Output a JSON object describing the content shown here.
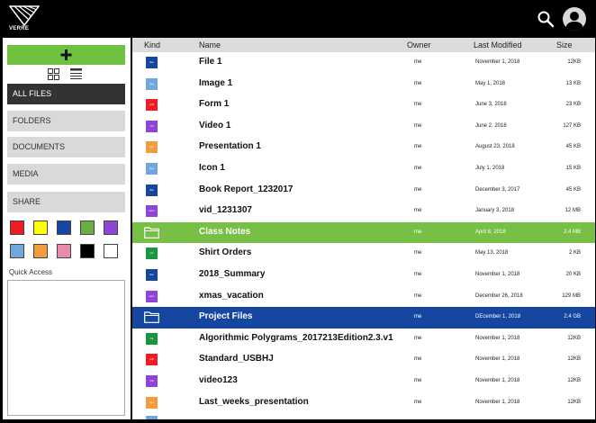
{
  "header": {
    "logo_text": "VERRE",
    "icons": {
      "search": "search-icon",
      "user": "user-icon"
    }
  },
  "sidebar": {
    "new_label": "+",
    "nav": [
      {
        "label": "ALL FILES",
        "active": true
      },
      {
        "label": "FOLDERS",
        "active": false
      },
      {
        "label": "DOCUMENTS",
        "active": false
      },
      {
        "label": "MEDIA",
        "active": false
      },
      {
        "label": "SHARE",
        "active": false
      }
    ],
    "swatches": [
      "#ee1c24",
      "#ffff00",
      "#1547a1",
      "#6cae45",
      "#8e44d6",
      "#6fa8dc",
      "#f39c3d",
      "#e98bab",
      "#000000",
      "#ffffff"
    ],
    "quick_access_label": "Quick Access"
  },
  "table": {
    "columns": {
      "kind": "Kind",
      "name": "Name",
      "owner": "Owner",
      "modified": "Last Modified",
      "size": "Size"
    },
    "rows": [
      {
        "kind": "doc",
        "kind_color": "#1547a1",
        "name": "File 1",
        "owner": "me",
        "modified": "November 1, 2018",
        "size": "12KB",
        "highlight": ""
      },
      {
        "kind": "img",
        "kind_color": "#6fa8dc",
        "name": "Image 1",
        "owner": "me",
        "modified": "May 1, 2018",
        "size": "13 KB",
        "highlight": ""
      },
      {
        "kind": "pdf",
        "kind_color": "#ee1c24",
        "name": "Form 1",
        "owner": "me",
        "modified": "June 3, 2018",
        "size": "23 KB",
        "highlight": ""
      },
      {
        "kind": "vid",
        "kind_color": "#8e44d6",
        "name": "Video 1",
        "owner": "me",
        "modified": "June 2, 2018",
        "size": "127 KB",
        "highlight": ""
      },
      {
        "kind": "ppt",
        "kind_color": "#f39c3d",
        "name": "Presentation 1",
        "owner": "me",
        "modified": "August 23, 2018",
        "size": "45 KB",
        "highlight": ""
      },
      {
        "kind": "img",
        "kind_color": "#6fa8dc",
        "name": "Icon 1",
        "owner": "me",
        "modified": "July 1, 2018",
        "size": "15 KB",
        "highlight": ""
      },
      {
        "kind": "doc",
        "kind_color": "#1547a1",
        "name": "Book Report_1232017",
        "owner": "me",
        "modified": "December 3, 2017",
        "size": "45 KB",
        "highlight": ""
      },
      {
        "kind": "wmv",
        "kind_color": "#8e44d6",
        "name": "vid_1231307",
        "owner": "me",
        "modified": "January 3, 2018",
        "size": "12 MB",
        "highlight": ""
      },
      {
        "kind": "folder",
        "kind_color": "#ffffff",
        "name": "Class Notes",
        "owner": "me",
        "modified": "April 8, 2018",
        "size": "2.4 MB",
        "highlight": "green"
      },
      {
        "kind": "xls",
        "kind_color": "#1a9641",
        "name": "Shirt Orders",
        "owner": "me",
        "modified": "May 13, 2018",
        "size": "2 KB",
        "highlight": ""
      },
      {
        "kind": "doc",
        "kind_color": "#1547a1",
        "name": "2018_Summary",
        "owner": "me",
        "modified": "November 1, 2018",
        "size": "20 KB",
        "highlight": ""
      },
      {
        "kind": "wmv",
        "kind_color": "#8e44d6",
        "name": "xmas_vacation",
        "owner": "me",
        "modified": "December 26, 2018",
        "size": "129 MB",
        "highlight": ""
      },
      {
        "kind": "folder",
        "kind_color": "#ffffff",
        "name": "Project Files",
        "owner": "me",
        "modified": "DEcember 1, 2018",
        "size": "2.4 GB",
        "highlight": "blue"
      },
      {
        "kind": "xls",
        "kind_color": "#1a9641",
        "name": "Algorithmic Polygrams_2017213Edition2.3.v1",
        "owner": "me",
        "modified": "November 1, 2018",
        "size": "12KB",
        "highlight": ""
      },
      {
        "kind": "pdf",
        "kind_color": "#ee1c24",
        "name": "Standard_USBHJ",
        "owner": "me",
        "modified": "November 1, 2018",
        "size": "12KB",
        "highlight": ""
      },
      {
        "kind": "vid",
        "kind_color": "#8e44d6",
        "name": "video123",
        "owner": "me",
        "modified": "November 1, 2018",
        "size": "12KB",
        "highlight": ""
      },
      {
        "kind": "ppt",
        "kind_color": "#f39c3d",
        "name": "Last_weeks_presentation",
        "owner": "me",
        "modified": "November 1, 2018",
        "size": "12KB",
        "highlight": ""
      }
    ]
  }
}
